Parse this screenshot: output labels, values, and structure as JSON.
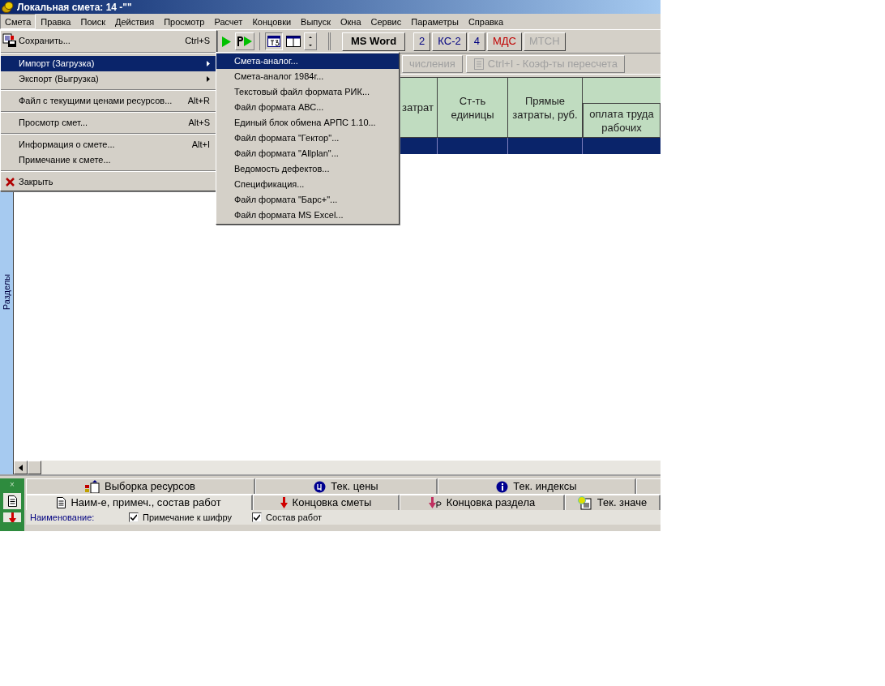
{
  "window": {
    "title": "Локальная смета: 14 -\"\""
  },
  "menu_bar": [
    {
      "label": "Смета",
      "selected": true
    },
    {
      "label": "Правка",
      "selected": false
    },
    {
      "label": "Поиск",
      "selected": false
    },
    {
      "label": "Действия",
      "selected": false
    },
    {
      "label": "Просмотр",
      "selected": false
    },
    {
      "label": "Расчет",
      "selected": false
    },
    {
      "label": "Концовки",
      "selected": false
    },
    {
      "label": "Выпуск",
      "selected": false
    },
    {
      "label": "Окна",
      "selected": false
    },
    {
      "label": "Сервис",
      "selected": false
    },
    {
      "label": "Параметры",
      "selected": false
    },
    {
      "label": "Справка",
      "selected": false
    }
  ],
  "toolbar": [
    {
      "label": "MS Word",
      "color": "#000000"
    },
    {
      "label": "2",
      "color": "#000080"
    },
    {
      "label": "КС-2",
      "color": "#000080"
    },
    {
      "label": "4",
      "color": "#000080"
    },
    {
      "label": "МДС",
      "color": "#c00000"
    },
    {
      "label": "МТСН",
      "color": "#a0a0a0"
    }
  ],
  "toolbar_2": [
    {
      "label": "числения",
      "disabled": true
    },
    {
      "label": "Ctrl+I - Коэф-ты пересчета",
      "disabled": true
    }
  ],
  "table": {
    "columns": [
      {
        "label": "затрат"
      },
      {
        "label": "Ст-ть единицы"
      },
      {
        "label": "Прямые затраты, руб."
      },
      {
        "sub_label": "оплата труда рабочих"
      }
    ],
    "rows": [
      {
        "selected": true
      }
    ]
  },
  "side_panel": {
    "label": "Разделы"
  },
  "menu": {
    "items": [
      {
        "kind": "save_item",
        "label": "Сохранить...",
        "shortcut": "Ctrl+S",
        "submenu": false,
        "selected": false
      },
      {
        "kind": "separator"
      },
      {
        "kind": "item",
        "label": "Импорт (Загрузка)",
        "submenu": true,
        "selected": true
      },
      {
        "kind": "item",
        "label": "Экспорт (Выгрузка)",
        "submenu": true,
        "selected": false
      },
      {
        "kind": "separator"
      },
      {
        "kind": "item",
        "label": "Файл с текущими ценами ресурсов...",
        "shortcut": "Alt+R",
        "submenu": false,
        "selected": false
      },
      {
        "kind": "separator"
      },
      {
        "kind": "item",
        "label": "Просмотр смет...",
        "shortcut": "Alt+S",
        "submenu": false,
        "selected": false
      },
      {
        "kind": "separator"
      },
      {
        "kind": "item",
        "label": "Информация о смете...",
        "shortcut": "Alt+I",
        "submenu": false,
        "selected": false
      },
      {
        "kind": "item",
        "label": "Примечание к смете...",
        "submenu": false,
        "selected": false
      },
      {
        "kind": "separator"
      },
      {
        "kind": "close_item",
        "label": "Закрыть",
        "submenu": false,
        "selected": false
      }
    ]
  },
  "submenu": {
    "items": [
      {
        "label": "Смета-аналог...",
        "selected": true
      },
      {
        "label": "Смета-аналог 1984г...",
        "selected": false
      },
      {
        "label": "Текстовый файл формата РИК...",
        "selected": false
      },
      {
        "label": "Файл формата АВС...",
        "selected": false
      },
      {
        "label": "Единый блок обмена АРПС 1.10...",
        "selected": false
      },
      {
        "label": "Файл формата \"Гектор\"...",
        "selected": false
      },
      {
        "label": "Файл формата \"Allplan\"...",
        "selected": false
      },
      {
        "label": "Ведомость дефектов...",
        "selected": false
      },
      {
        "label": "Спецификация...",
        "selected": false
      },
      {
        "label": "Файл формата \"Барс+\"...",
        "selected": false
      },
      {
        "label": "Файл формата MS Excel...",
        "selected": false
      }
    ]
  },
  "bottom_panel": {
    "close": "×",
    "tabs_row_1": [
      {
        "label": "Выборка ресурсов"
      },
      {
        "label": "Тек. цены"
      },
      {
        "label": "Тек. индексы"
      }
    ],
    "tabs_row_2": [
      {
        "label": "Наим-е, примеч., состав работ",
        "selected": true
      },
      {
        "label": "Концовка сметы",
        "selected": false
      },
      {
        "label": "Концовка раздела",
        "selected": false
      },
      {
        "label": "Тек. значе",
        "selected": false
      }
    ],
    "field_label": "Наименование:",
    "checkboxes": [
      {
        "label": "Примечание к шифру",
        "checked": true
      },
      {
        "label": "Состав работ",
        "checked": true
      }
    ]
  }
}
